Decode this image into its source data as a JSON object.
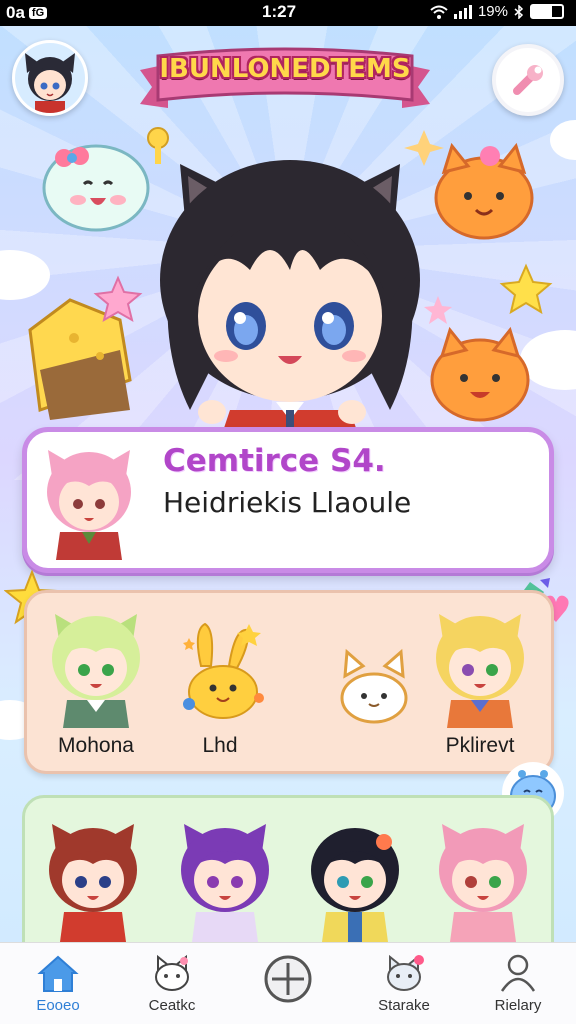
{
  "status_bar": {
    "left_text": "0a",
    "left_badge": "fG",
    "time": "1:27",
    "battery_text": "19%"
  },
  "header": {
    "title": "IBUNLONEDTEMS",
    "avatar_icon": "player-avatar",
    "settings_icon": "wrench-icon"
  },
  "featured": {
    "title": "Cemtirce S4.",
    "subtitle": "Heidriekis Llaoule"
  },
  "characters": [
    {
      "name": "Mohona",
      "hair": "#d6ef9a"
    },
    {
      "name": "Lhd",
      "hair": "#ffd040"
    },
    {
      "name": "",
      "hair": "#ffffff"
    },
    {
      "name": "Pklirevt",
      "hair": "#f5d460"
    }
  ],
  "roster": [
    {
      "hair": "#a0392c"
    },
    {
      "hair": "#7b3bb5"
    },
    {
      "hair": "#1f1f2e"
    },
    {
      "hair": "#f29ab8"
    }
  ],
  "nav": [
    {
      "label": "Eooeo",
      "icon": "home-icon",
      "active": true
    },
    {
      "label": "Ceatkc",
      "icon": "cat-icon",
      "active": false
    },
    {
      "label": "",
      "icon": "plus-circle-icon",
      "active": false
    },
    {
      "label": "Starake",
      "icon": "cat-badge-icon",
      "active": false
    },
    {
      "label": "Rielary",
      "icon": "person-icon",
      "active": false
    }
  ],
  "colors": {
    "accent": "#b146c9",
    "nav_active": "#2f7fd6",
    "card_border": "#c98be6",
    "banner": "#e76aa5"
  }
}
